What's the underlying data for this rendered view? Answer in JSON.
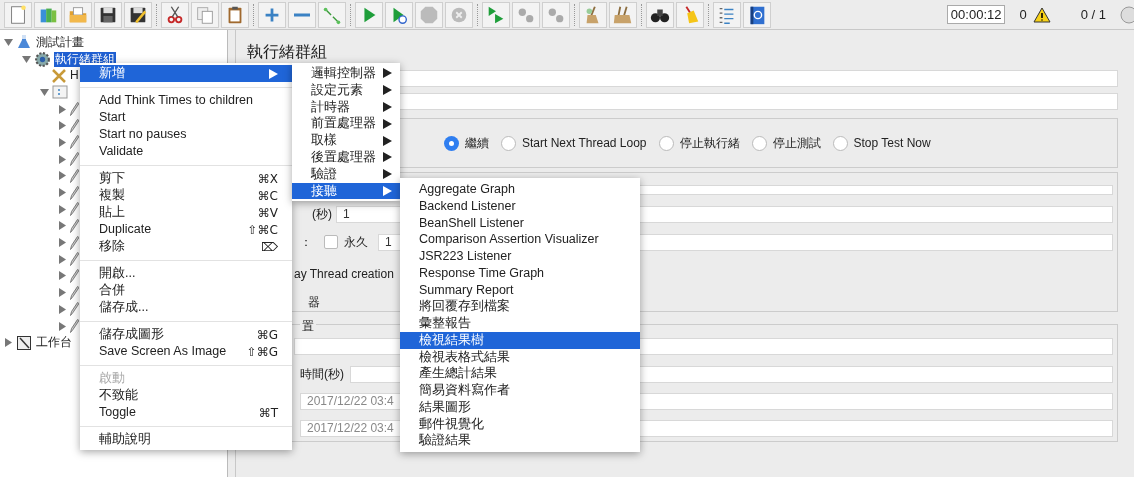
{
  "toolbar": {
    "timer": "00:00:12",
    "error_count": "0",
    "active_threads": "0 / 1"
  },
  "tree": [
    {
      "label": "測試計畫",
      "kind": "plan",
      "expanded": true,
      "selected": false,
      "children": [
        {
          "label": "執行緒群組",
          "kind": "thread-group",
          "expanded": true,
          "selected": true,
          "children": [
            {
              "label": "H",
              "kind": "config",
              "selected": false
            },
            {
              "kind": "controller",
              "expanded": true,
              "children": [
                {
                  "kind": "sampler",
                  "expanded": false
                },
                {
                  "kind": "sampler",
                  "expanded": false
                },
                {
                  "kind": "sampler",
                  "expanded": false
                },
                {
                  "kind": "sampler",
                  "expanded": false
                },
                {
                  "kind": "sampler",
                  "expanded": false
                },
                {
                  "kind": "sampler",
                  "expanded": false
                },
                {
                  "kind": "sampler",
                  "expanded": false
                },
                {
                  "kind": "sampler",
                  "expanded": false
                },
                {
                  "kind": "sampler",
                  "expanded": false
                },
                {
                  "kind": "sampler",
                  "expanded": false
                },
                {
                  "kind": "sampler",
                  "expanded": false
                },
                {
                  "kind": "sampler",
                  "expanded": false
                },
                {
                  "kind": "sampler",
                  "expanded": false
                },
                {
                  "kind": "sampler",
                  "expanded": false
                }
              ]
            }
          ]
        }
      ]
    },
    {
      "label": "工作台",
      "kind": "workbench",
      "expanded": false,
      "selected": false
    }
  ],
  "panel": {
    "title": "執行緒群組",
    "error_actions": [
      {
        "label": "繼續",
        "selected": true
      },
      {
        "label": "Start Next Thread Loop",
        "selected": false
      },
      {
        "label": "停止執行緒",
        "selected": false
      },
      {
        "label": "停止測試",
        "selected": false
      },
      {
        "label": "Stop Test Now",
        "selected": false
      }
    ],
    "thread_properties": {
      "ramp_label": "(秒)",
      "ramp_value": "1",
      "loop_label": "：",
      "forever": {
        "label": "永久",
        "checked": false
      },
      "loop_value": "1",
      "delay_label": "ay Thread creation",
      "scheduler_label": "器"
    },
    "scheduler": {
      "legend": "置",
      "duration_label": "時間(秒)",
      "start_time": "2017/12/22 03:4",
      "end_time": "2017/12/22 03:4"
    }
  },
  "context_menu": {
    "items": [
      {
        "kind": "item",
        "label": "新增",
        "submenu": true,
        "selected": true,
        "disabled": false
      },
      {
        "kind": "separator"
      },
      {
        "kind": "item",
        "label": "Add Think Times to children",
        "submenu": false,
        "selected": false,
        "disabled": false
      },
      {
        "kind": "item",
        "label": "Start",
        "submenu": false,
        "selected": false,
        "disabled": false
      },
      {
        "kind": "item",
        "label": "Start no pauses",
        "submenu": false,
        "selected": false,
        "disabled": false
      },
      {
        "kind": "item",
        "label": "Validate",
        "submenu": false,
        "selected": false,
        "disabled": false
      },
      {
        "kind": "separator"
      },
      {
        "kind": "item",
        "label": "剪下",
        "shortcut": "⌘X",
        "submenu": false,
        "selected": false,
        "disabled": false
      },
      {
        "kind": "item",
        "label": "複製",
        "shortcut": "⌘C",
        "submenu": false,
        "selected": false,
        "disabled": false
      },
      {
        "kind": "item",
        "label": "貼上",
        "shortcut": "⌘V",
        "submenu": false,
        "selected": false,
        "disabled": false
      },
      {
        "kind": "item",
        "label": "Duplicate",
        "shortcut": "⇧⌘C",
        "submenu": false,
        "selected": false,
        "disabled": false
      },
      {
        "kind": "item",
        "label": "移除",
        "shortcut": "⌦",
        "submenu": false,
        "selected": false,
        "disabled": false
      },
      {
        "kind": "separator"
      },
      {
        "kind": "item",
        "label": "開啟...",
        "submenu": false,
        "selected": false,
        "disabled": false
      },
      {
        "kind": "item",
        "label": "合併",
        "submenu": false,
        "selected": false,
        "disabled": false
      },
      {
        "kind": "item",
        "label": "儲存成...",
        "submenu": false,
        "selected": false,
        "disabled": false
      },
      {
        "kind": "separator"
      },
      {
        "kind": "item",
        "label": "儲存成圖形",
        "shortcut": "⌘G",
        "submenu": false,
        "selected": false,
        "disabled": false
      },
      {
        "kind": "item",
        "label": "Save Screen As Image",
        "shortcut": "⇧⌘G",
        "submenu": false,
        "selected": false,
        "disabled": false
      },
      {
        "kind": "separator"
      },
      {
        "kind": "item",
        "label": "啟動",
        "submenu": false,
        "selected": false,
        "disabled": true
      },
      {
        "kind": "item",
        "label": "不致能",
        "submenu": false,
        "selected": false,
        "disabled": false
      },
      {
        "kind": "item",
        "label": "Toggle",
        "shortcut": "⌘T",
        "submenu": false,
        "selected": false,
        "disabled": false
      },
      {
        "kind": "separator"
      },
      {
        "kind": "item",
        "label": "輔助說明",
        "submenu": false,
        "selected": false,
        "disabled": false
      }
    ]
  },
  "add_submenu": {
    "items": [
      {
        "label": "邏輯控制器",
        "submenu": true,
        "selected": false
      },
      {
        "label": "設定元素",
        "submenu": true,
        "selected": false
      },
      {
        "label": "計時器",
        "submenu": true,
        "selected": false
      },
      {
        "label": "前置處理器",
        "submenu": true,
        "selected": false
      },
      {
        "label": "取樣",
        "submenu": true,
        "selected": false
      },
      {
        "label": "後置處理器",
        "submenu": true,
        "selected": false
      },
      {
        "label": "驗證",
        "submenu": true,
        "selected": false
      },
      {
        "label": "接聽",
        "submenu": true,
        "selected": true
      }
    ]
  },
  "listener_submenu": {
    "items": [
      {
        "label": "Aggregate Graph",
        "selected": false
      },
      {
        "label": "Backend Listener",
        "selected": false
      },
      {
        "label": "BeanShell Listener",
        "selected": false
      },
      {
        "label": "Comparison Assertion Visualizer",
        "selected": false
      },
      {
        "label": "JSR223 Listener",
        "selected": false
      },
      {
        "label": "Response Time Graph",
        "selected": false
      },
      {
        "label": "Summary Report",
        "selected": false
      },
      {
        "label": "將回覆存到檔案",
        "selected": false
      },
      {
        "label": "彙整報告",
        "selected": false
      },
      {
        "label": "檢視結果樹",
        "selected": true
      },
      {
        "label": "檢視表格式結果",
        "selected": false
      },
      {
        "label": "產生總計結果",
        "selected": false
      },
      {
        "label": "簡易資料寫作者",
        "selected": false
      },
      {
        "label": "結果圖形",
        "selected": false
      },
      {
        "label": "郵件視覺化",
        "selected": false
      },
      {
        "label": "驗證結果",
        "selected": false
      }
    ]
  }
}
